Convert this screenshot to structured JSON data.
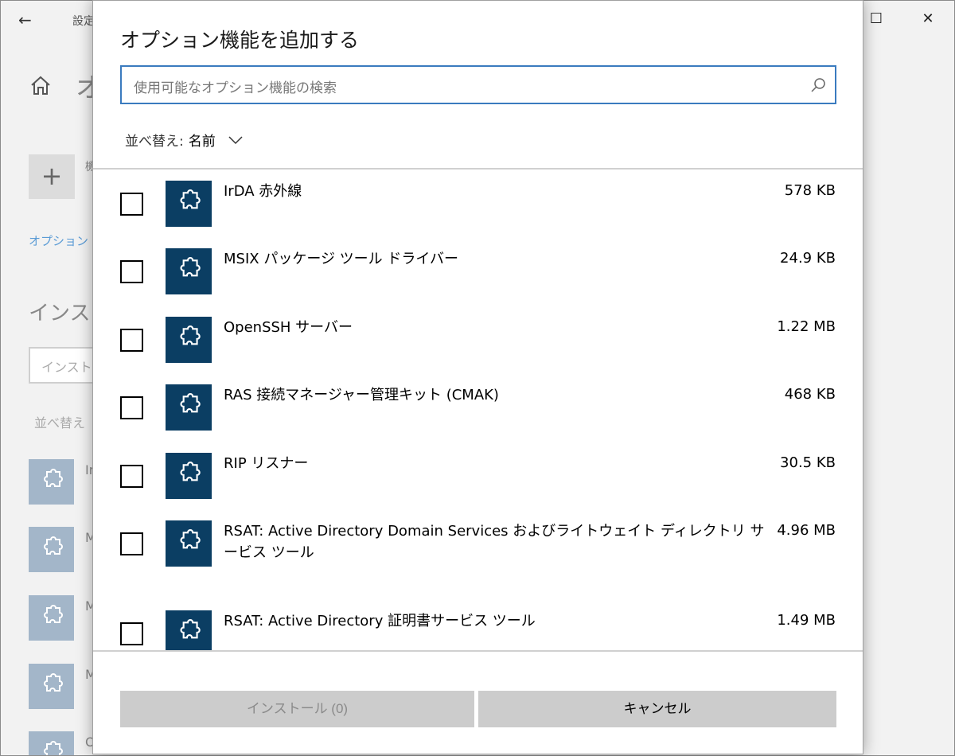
{
  "background": {
    "title": "設定",
    "heading": "オ",
    "add_label": "機",
    "link": "オプション",
    "installed_heading": "インスト",
    "search_placeholder": "インストー",
    "sort_label": "並べ替え",
    "item_letters": [
      "Ir",
      "M",
      "M",
      "M",
      "O"
    ]
  },
  "dialog": {
    "title": "オプション機能を追加する",
    "search": {
      "placeholder": "使用可能なオプション機能の検索"
    },
    "sort": {
      "label": "並べ替え:",
      "value": "名前"
    },
    "features": [
      {
        "name": "IrDA 赤外線",
        "size": "578 KB"
      },
      {
        "name": "MSIX パッケージ ツール ドライバー",
        "size": "24.9 KB"
      },
      {
        "name": "OpenSSH サーバー",
        "size": "1.22 MB"
      },
      {
        "name": "RAS 接続マネージャー管理キット (CMAK)",
        "size": "468 KB"
      },
      {
        "name": "RIP リスナー",
        "size": "30.5 KB"
      },
      {
        "name": "RSAT: Active Directory Domain Services およびライトウェイト ディレクトリ サービス ツール",
        "size": "4.96 MB"
      },
      {
        "name": "RSAT: Active Directory 証明書サービス ツール",
        "size": "1.49 MB"
      }
    ],
    "buttons": {
      "install": "インストール (0)",
      "cancel": "キャンセル"
    }
  },
  "colors": {
    "accent": "#3a7bbf",
    "icon_bg": "#0b3e63",
    "button_bg": "#cccccc"
  },
  "window_controls": {
    "minimize": "—",
    "maximize": "☐",
    "close": "✕"
  }
}
